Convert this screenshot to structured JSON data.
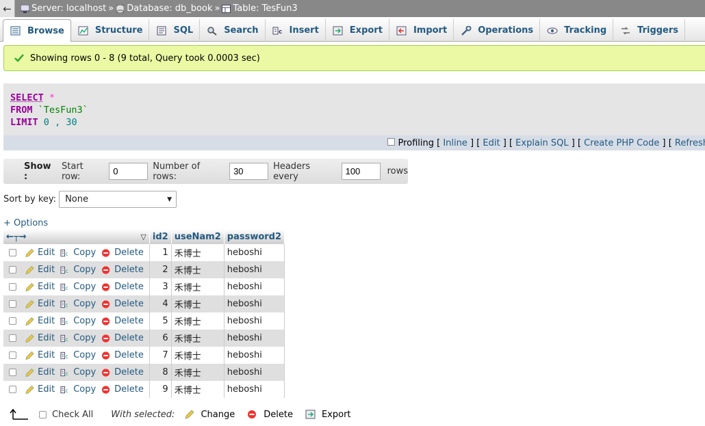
{
  "breadcrumb": {
    "back_glyph": "←",
    "server": "Server: localhost",
    "database": "Database: db_book",
    "table": "Table: TesFun3",
    "sep": "»"
  },
  "tabs": [
    {
      "label": "Browse",
      "icon": "browse-icon",
      "active": true
    },
    {
      "label": "Structure",
      "icon": "structure-icon"
    },
    {
      "label": "SQL",
      "icon": "sql-icon"
    },
    {
      "label": "Search",
      "icon": "search-icon"
    },
    {
      "label": "Insert",
      "icon": "insert-icon"
    },
    {
      "label": "Export",
      "icon": "export-icon"
    },
    {
      "label": "Import",
      "icon": "import-icon"
    },
    {
      "label": "Operations",
      "icon": "operations-icon"
    },
    {
      "label": "Tracking",
      "icon": "tracking-icon"
    },
    {
      "label": "Triggers",
      "icon": "triggers-icon"
    }
  ],
  "message": "Showing rows 0 - 8 (9 total, Query took 0.0003 sec)",
  "sql": {
    "select": "SELECT",
    "star": "*",
    "from": "FROM",
    "table": "`TesFun3`",
    "limit": "LIMIT",
    "offset": "0",
    "comma": ",",
    "count": "30"
  },
  "sql_links": {
    "profiling": "Profiling",
    "inline": "Inline",
    "edit": "Edit",
    "explain": "Explain SQL",
    "php": "Create PHP Code",
    "refresh": "Refresh"
  },
  "nav": {
    "show": "Show :",
    "start_row_label": "Start row:",
    "start_row": "0",
    "num_rows_label": "Number of rows:",
    "num_rows": "30",
    "headers_label": "Headers every",
    "headers": "100",
    "rows_label": "rows"
  },
  "sort": {
    "label": "Sort by key:",
    "value": "None"
  },
  "options_link": "+ Options",
  "columns": [
    "id2",
    "useNam2",
    "password2"
  ],
  "row_actions": {
    "edit": "Edit",
    "copy": "Copy",
    "delete": "Delete"
  },
  "rows": [
    {
      "id": "1",
      "user": "禾博士",
      "password": "heboshi"
    },
    {
      "id": "2",
      "user": "禾博士",
      "password": "heboshi"
    },
    {
      "id": "3",
      "user": "禾博士",
      "password": "heboshi"
    },
    {
      "id": "4",
      "user": "禾博士",
      "password": "heboshi"
    },
    {
      "id": "5",
      "user": "禾博士",
      "password": "heboshi"
    },
    {
      "id": "6",
      "user": "禾博士",
      "password": "heboshi"
    },
    {
      "id": "7",
      "user": "禾博士",
      "password": "heboshi"
    },
    {
      "id": "8",
      "user": "禾博士",
      "password": "heboshi"
    },
    {
      "id": "9",
      "user": "禾博士",
      "password": "heboshi"
    }
  ],
  "bottom": {
    "check_all": "Check All",
    "with_selected": "With selected:",
    "change": "Change",
    "delete": "Delete",
    "export": "Export"
  },
  "colors": {
    "link": "#235a81",
    "success_bg": "#ebf8a4",
    "keyword": "#990099"
  }
}
